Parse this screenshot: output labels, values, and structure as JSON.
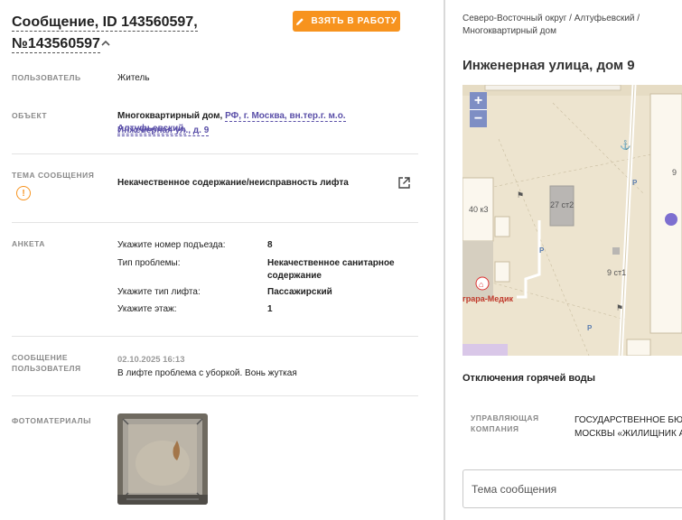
{
  "header": {
    "title_line1": "Сообщение, ID 143560597,",
    "title_line2": "№143560597",
    "take_button": "ВЗЯТЬ В РАБОТУ"
  },
  "fields": {
    "user_label": "ПОЛЬЗОВАТЕЛЬ",
    "user_value": "Житель",
    "object_label": "ОБЪЕКТ",
    "object_value_plain": "Многоквартирный дом,",
    "object_value_link1": "РФ, г. Москва, вн.тер.г. м.о. Алтуфьевский,",
    "object_value_link2": "Инженерная ул., д. 9",
    "topic_label_line1": "ТЕМА СООБЩЕНИЯ",
    "topic_value": "Некачественное содержание/неисправность лифта",
    "survey_label": "АНКЕТА",
    "survey": [
      {
        "q": "Укажите номер подъезда:",
        "a": "8"
      },
      {
        "q": "Тип проблемы:",
        "a": "Некачественное санитарное содержание"
      },
      {
        "q": "Укажите тип лифта:",
        "a": "Пассажирский"
      },
      {
        "q": "Укажите этаж:",
        "a": "1"
      }
    ],
    "message_label_line1": "СООБЩЕНИЕ",
    "message_label_line2": "ПОЛЬЗОВАТЕЛЯ",
    "message_date": "02.10.2025 16:13",
    "message_text": "В лифте проблема с уборкой. Вонь жуткая",
    "photo_label": "ФОТОМАТЕРИАЛЫ"
  },
  "right": {
    "breadcrumb_line1": "Северо-Восточный округ / Алтуфьевский /",
    "breadcrumb_line2": "Многоквартирный дом",
    "address": "Инженерная улица, дом 9",
    "map_labels": {
      "b1": "40 к3",
      "b2": "27 ст2",
      "b3": "9 ст1",
      "b4": "9",
      "poi": "грара-Медик",
      "parking": "P"
    },
    "zoom_in": "+",
    "zoom_out": "−",
    "outage_title": "Отключения горячей воды",
    "mc_label_line1": "УПРАВЛЯЮЩАЯ",
    "mc_label_line2": "КОМПАНИЯ",
    "mc_value_line1": "ГОСУДАРСТВЕННОЕ БЮД",
    "mc_value_line2": "МОСКВЫ «ЖИЛИЩНИК А",
    "topic_placeholder": "Тема сообщения"
  },
  "colors": {
    "accent_orange": "#f7931e",
    "link_purple": "#5a4fa8",
    "label_gray": "#8a8a8a"
  }
}
